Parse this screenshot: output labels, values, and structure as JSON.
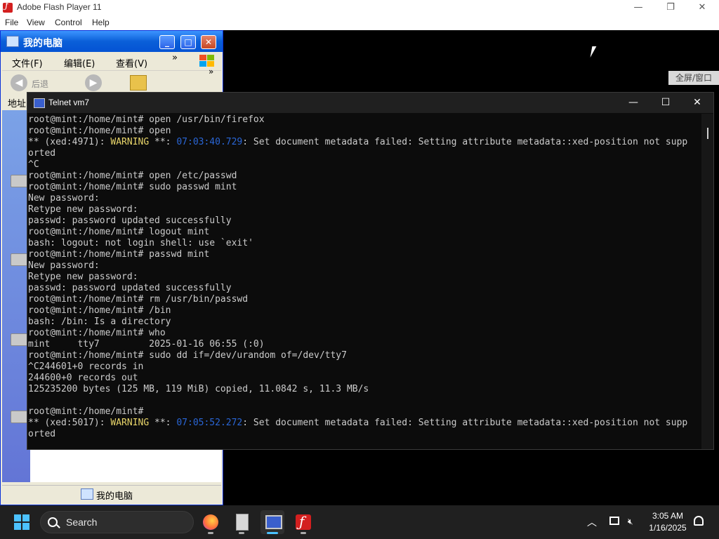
{
  "flash_window": {
    "title": "Adobe Flash Player 11",
    "menu": [
      "File",
      "View",
      "Control",
      "Help"
    ],
    "controls": {
      "minimize": "—",
      "restore": "❐",
      "close": "✕"
    }
  },
  "fullscreen_button": "全屏/窗口",
  "explorer": {
    "title": "我的电脑",
    "menu": [
      "文件(F)",
      "编辑(E)",
      "查看(V)"
    ],
    "menu_more": "»",
    "toolbar_more": "»",
    "back_label": "后退",
    "address_label": "地址",
    "status_label": "我的电脑",
    "buttons": {
      "minimize": "_",
      "maximize": "□",
      "close": "✕"
    }
  },
  "telnet": {
    "title": "Telnet vm7",
    "controls": {
      "minimize": "—",
      "maximize": "☐",
      "close": "✕"
    },
    "lines": [
      {
        "segments": [
          {
            "text": "root@mint:/home/mint# open /usr/bin/firefox"
          }
        ]
      },
      {
        "segments": [
          {
            "text": "root@mint:/home/mint# open"
          }
        ]
      },
      {
        "segments": [
          {
            "text": "** (xed:4971): "
          },
          {
            "text": "WARNING",
            "style": "warn"
          },
          {
            "text": " **: "
          },
          {
            "text": "07:03:40.729",
            "style": "ts"
          },
          {
            "text": ": Set document metadata failed: Setting attribute metadata::xed-position not supp"
          }
        ]
      },
      {
        "segments": [
          {
            "text": "orted"
          }
        ]
      },
      {
        "segments": [
          {
            "text": "^C"
          }
        ]
      },
      {
        "segments": [
          {
            "text": "root@mint:/home/mint# open /etc/passwd"
          }
        ]
      },
      {
        "segments": [
          {
            "text": "root@mint:/home/mint# sudo passwd mint"
          }
        ]
      },
      {
        "segments": [
          {
            "text": "New password:"
          }
        ]
      },
      {
        "segments": [
          {
            "text": "Retype new password:"
          }
        ]
      },
      {
        "segments": [
          {
            "text": "passwd: password updated successfully"
          }
        ]
      },
      {
        "segments": [
          {
            "text": "root@mint:/home/mint# logout mint"
          }
        ]
      },
      {
        "segments": [
          {
            "text": "bash: logout: not login shell: use `exit'"
          }
        ]
      },
      {
        "segments": [
          {
            "text": "root@mint:/home/mint# passwd mint"
          }
        ]
      },
      {
        "segments": [
          {
            "text": "New password:"
          }
        ]
      },
      {
        "segments": [
          {
            "text": "Retype new password:"
          }
        ]
      },
      {
        "segments": [
          {
            "text": "passwd: password updated successfully"
          }
        ]
      },
      {
        "segments": [
          {
            "text": "root@mint:/home/mint# rm /usr/bin/passwd"
          }
        ]
      },
      {
        "segments": [
          {
            "text": "root@mint:/home/mint# /bin"
          }
        ]
      },
      {
        "segments": [
          {
            "text": "bash: /bin: Is a directory"
          }
        ]
      },
      {
        "segments": [
          {
            "text": "root@mint:/home/mint# who"
          }
        ]
      },
      {
        "segments": [
          {
            "text": "mint     tty7         2025-01-16 06:55 (:0)"
          }
        ]
      },
      {
        "segments": [
          {
            "text": "root@mint:/home/mint# sudo dd if=/dev/urandom of=/dev/tty7"
          }
        ]
      },
      {
        "segments": [
          {
            "text": "^C244601+0 records in"
          }
        ]
      },
      {
        "segments": [
          {
            "text": "244600+0 records out"
          }
        ]
      },
      {
        "segments": [
          {
            "text": "125235200 bytes (125 MB, 119 MiB) copied, 11.0842 s, 11.3 MB/s"
          }
        ]
      },
      {
        "segments": [
          {
            "text": ""
          }
        ]
      },
      {
        "segments": [
          {
            "text": "root@mint:/home/mint#"
          }
        ]
      },
      {
        "segments": [
          {
            "text": "** (xed:5017): "
          },
          {
            "text": "WARNING",
            "style": "warn"
          },
          {
            "text": " **: "
          },
          {
            "text": "07:05:52.272",
            "style": "ts"
          },
          {
            "text": ": Set document metadata failed: Setting attribute metadata::xed-position not supp"
          }
        ]
      },
      {
        "segments": [
          {
            "text": "orted"
          }
        ]
      }
    ]
  },
  "taskbar": {
    "search_label": "Search",
    "apps": [
      "firefox-icon",
      "document-icon",
      "telnet-icon",
      "flash-player-icon"
    ],
    "time": "3:05 AM",
    "date": "1/16/2025"
  },
  "colors": {
    "warning": "#e8d56a",
    "timestamp": "#2a66d6",
    "terminal_text": "#cccccc",
    "accent": "#4cc2ff"
  }
}
